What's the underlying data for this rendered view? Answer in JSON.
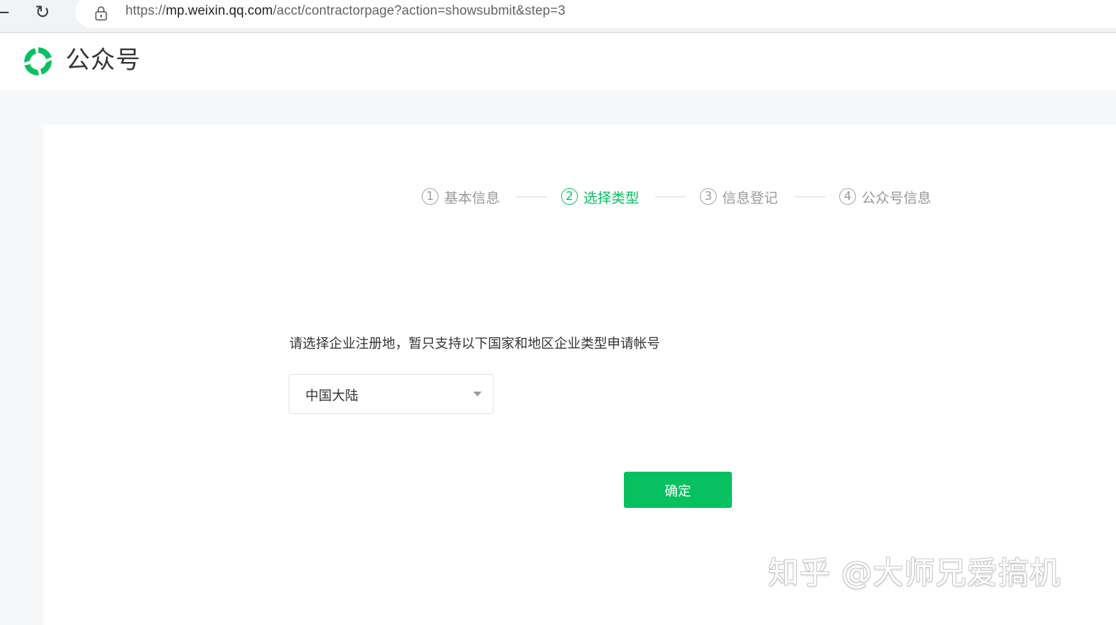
{
  "browser": {
    "back_icon": "back-arrow-icon",
    "reload_icon": "reload-icon",
    "lock_icon": "lock-icon",
    "url_scheme": "https://",
    "url_host": "mp.weixin.qq.com",
    "url_path": "/acct/contractorpage?action=showsubmit&step=3"
  },
  "header": {
    "logo_icon": "wechat-official-account-logo-icon",
    "title": "公众号"
  },
  "steps": [
    {
      "number": "1",
      "label": "基本信息",
      "active": false
    },
    {
      "number": "2",
      "label": "选择类型",
      "active": true
    },
    {
      "number": "3",
      "label": "信息登记",
      "active": false
    },
    {
      "number": "4",
      "label": "公众号信息",
      "active": false
    }
  ],
  "form": {
    "hint": "请选择企业注册地，暂只支持以下国家和地区企业类型申请帐号",
    "region_selected": "中国大陆",
    "confirm_label": "确定"
  },
  "watermark": "知乎 @大师兄爱搞机",
  "colors": {
    "accent": "#07c160",
    "page_bg": "#f6f7f9",
    "text": "#353535",
    "muted": "#9a9a9a"
  }
}
